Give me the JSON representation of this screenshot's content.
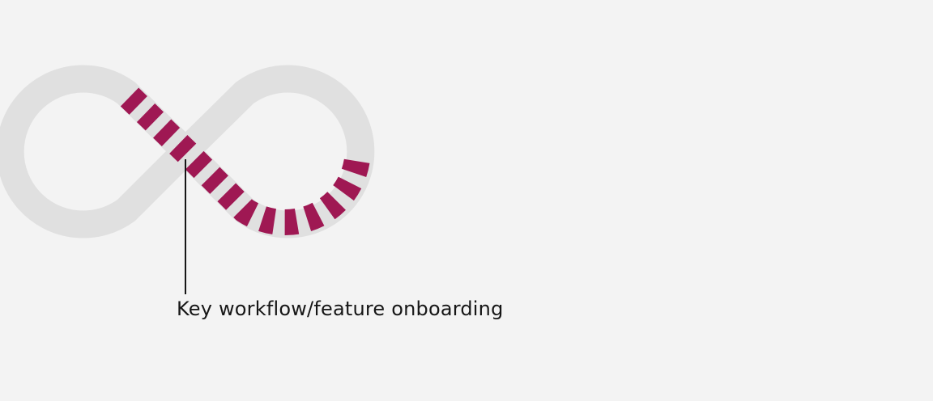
{
  "diagram": {
    "callout": {
      "label": "Key workflow/feature onboarding"
    },
    "colors": {
      "background": "#f3f3f3",
      "loop": "#e0e0e0",
      "highlight": "#9f1853",
      "leader": "#161616"
    }
  }
}
